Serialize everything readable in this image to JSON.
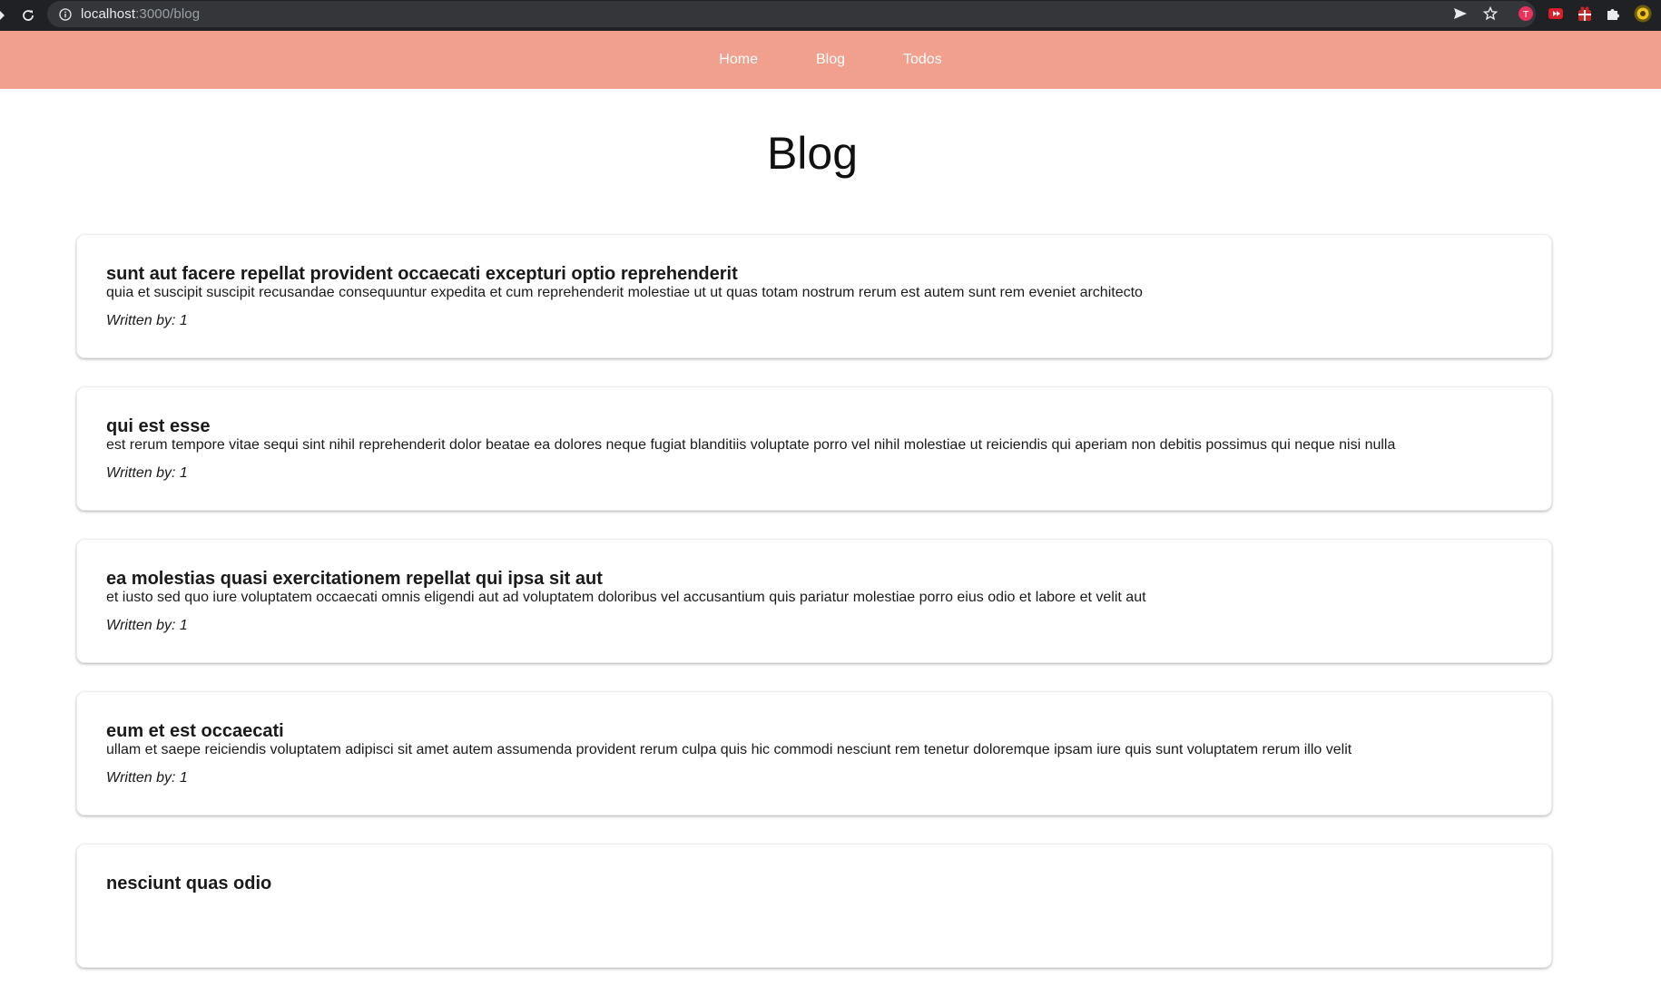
{
  "browser": {
    "url_host": "localhost",
    "url_rest": ":3000/blog"
  },
  "nav": {
    "items": [
      {
        "label": "Home"
      },
      {
        "label": "Blog"
      },
      {
        "label": "Todos"
      }
    ]
  },
  "page": {
    "title": "Blog",
    "author_prefix": "Written by: "
  },
  "posts": [
    {
      "title": "sunt aut facere repellat provident occaecati excepturi optio reprehenderit",
      "body": "quia et suscipit suscipit recusandae consequuntur expedita et cum reprehenderit molestiae ut ut quas totam nostrum rerum est autem sunt rem eveniet architecto",
      "author": "Written by: 1"
    },
    {
      "title": "qui est esse",
      "body": "est rerum tempore vitae sequi sint nihil reprehenderit dolor beatae ea dolores neque fugiat blanditiis voluptate porro vel nihil molestiae ut reiciendis qui aperiam non debitis possimus qui neque nisi nulla",
      "author": "Written by: 1"
    },
    {
      "title": "ea molestias quasi exercitationem repellat qui ipsa sit aut",
      "body": "et iusto sed quo iure voluptatem occaecati omnis eligendi aut ad voluptatem doloribus vel accusantium quis pariatur molestiae porro eius odio et labore et velit aut",
      "author": "Written by: 1"
    },
    {
      "title": "eum et est occaecati",
      "body": "ullam et saepe reiciendis voluptatem adipisci sit amet autem assumenda provident rerum culpa quis hic commodi nesciunt rem tenetur doloremque ipsam iure quis sunt voluptatem rerum illo velit",
      "author": "Written by: 1"
    },
    {
      "title": "nesciunt quas odio",
      "body": "",
      "author": ""
    }
  ],
  "colors": {
    "nav_bg": "#f0a08c",
    "chrome_bg": "#202124"
  }
}
